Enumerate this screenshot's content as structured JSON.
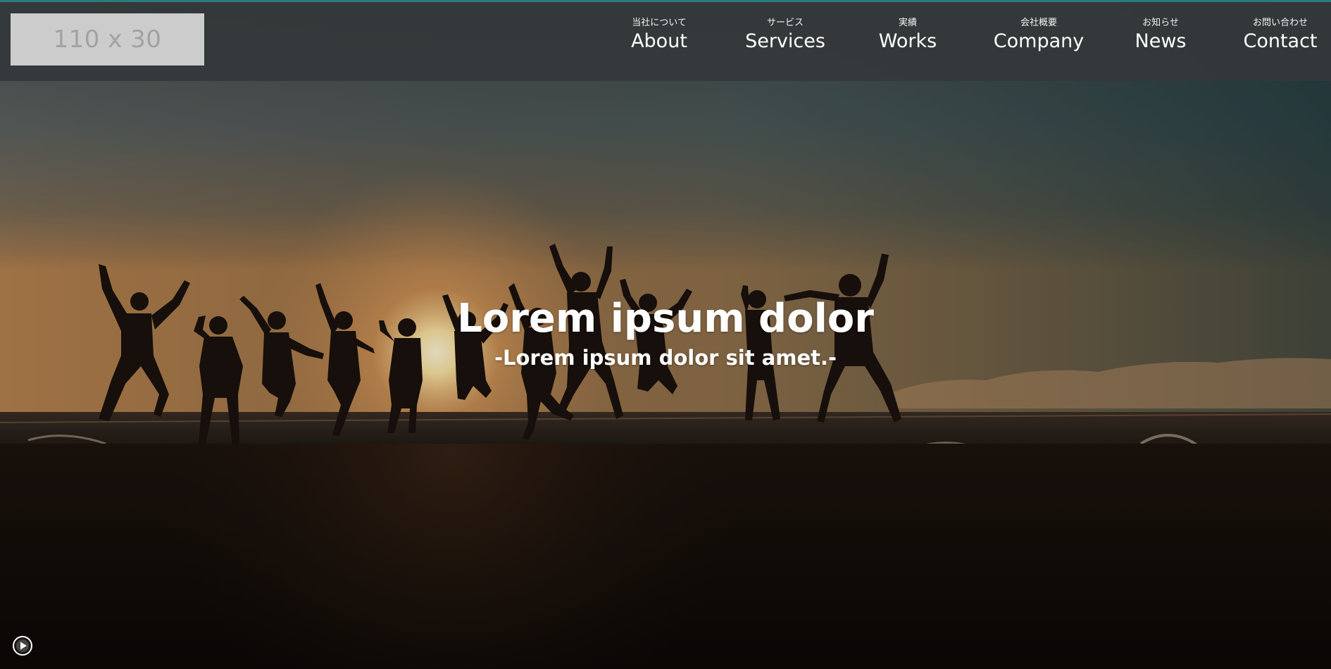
{
  "header": {
    "logo_text": "110 x 30",
    "nav": [
      {
        "sub": "当社について",
        "label": "About"
      },
      {
        "sub": "サービス",
        "label": "Services"
      },
      {
        "sub": "実績",
        "label": "Works"
      },
      {
        "sub": "会社概要",
        "label": "Company"
      },
      {
        "sub": "お知らせ",
        "label": "News"
      },
      {
        "sub": "お問い合わせ",
        "label": "Contact"
      }
    ]
  },
  "hero": {
    "title": "Lorem ipsum dolor",
    "subtitle": "-Lorem ipsum dolor sit amet.-",
    "background": "sunset-beach-jumping-people-photo"
  },
  "controls": {
    "play_icon": "play-circle-icon"
  },
  "colors": {
    "header_bg": "#34383a",
    "accent": "#2b7a80",
    "logo_bg": "#cccccc",
    "logo_text": "#a2a2a2",
    "text": "#ffffff"
  }
}
